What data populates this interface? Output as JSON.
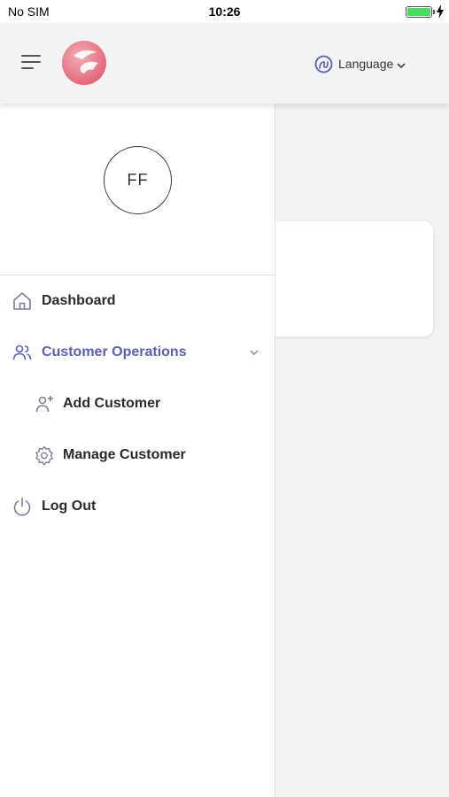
{
  "status_bar": {
    "carrier": "No SIM",
    "time": "10:26",
    "battery_percent": 100,
    "charging": true
  },
  "header": {
    "language_label": "Language"
  },
  "profile": {
    "initials": "FF"
  },
  "menu": {
    "dashboard": "Dashboard",
    "customer_operations": "Customer Operations",
    "add_customer": "Add Customer",
    "manage_customer": "Manage Customer",
    "log_out": "Log Out"
  },
  "colors": {
    "accent": "#5a5fb5",
    "brand": "#e0475b",
    "battery": "#4cd964"
  },
  "icons": [
    "hamburger-menu-icon",
    "brand-logo",
    "globe-icon",
    "chevron-down-icon",
    "home-icon",
    "users-icon",
    "user-plus-icon",
    "gear-icon",
    "power-icon",
    "charging-bolt-icon"
  ]
}
